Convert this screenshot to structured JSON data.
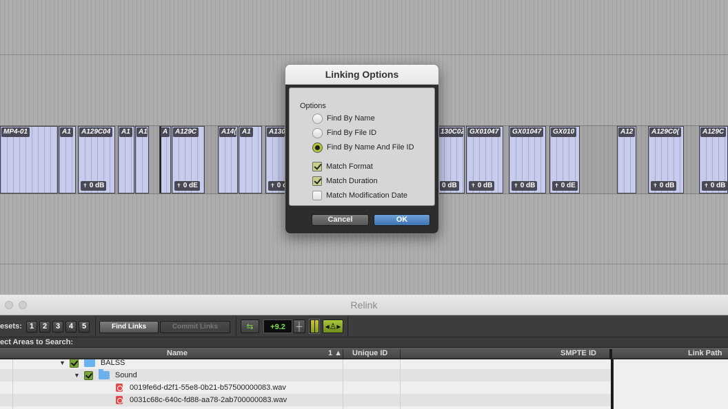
{
  "timeline": {
    "clips": [
      {
        "name": "MP4-01",
        "gain": ""
      },
      {
        "name": "A1",
        "gain": ""
      },
      {
        "name": "A129C04",
        "gain": "0 dB"
      },
      {
        "name": "A1",
        "gain": ""
      },
      {
        "name": "A1",
        "gain": ""
      },
      {
        "name": "A",
        "gain": ""
      },
      {
        "name": "A129C",
        "gain": "0 dE"
      },
      {
        "name": "A14(",
        "gain": ""
      },
      {
        "name": "A1",
        "gain": ""
      },
      {
        "name": "A130",
        "gain": "0 d"
      },
      {
        "name": "130C0Z",
        "gain": "0 dB"
      },
      {
        "name": "GX01047",
        "gain": "0 dB"
      },
      {
        "name": "GX01047",
        "gain": "0 dB"
      },
      {
        "name": "GX010",
        "gain": "0 dE"
      },
      {
        "name": "A12",
        "gain": ""
      },
      {
        "name": "A129C0(",
        "gain": "0 dB"
      },
      {
        "name": "A129C",
        "gain": "0 dB"
      }
    ]
  },
  "dialog": {
    "title": "Linking Options",
    "options_heading": "Options",
    "radios": [
      {
        "label": "Find By Name",
        "selected": false
      },
      {
        "label": "Find By File ID",
        "selected": false
      },
      {
        "label": "Find By Name And File ID",
        "selected": true
      }
    ],
    "checks": [
      {
        "label": "Match Format",
        "checked": true
      },
      {
        "label": "Match Duration",
        "checked": true
      },
      {
        "label": "Match Modification Date",
        "checked": false
      }
    ],
    "cancel_label": "Cancel",
    "ok_label": "OK"
  },
  "relink": {
    "title": "Relink",
    "presets_label": "esets:",
    "presets": [
      "1",
      "2",
      "3",
      "4",
      "5"
    ],
    "find_links_label": "Find Links",
    "commit_links_label": "Commit Links",
    "readout": "+9.2",
    "select_areas_label": "ect Areas to Search:",
    "columns": {
      "name": "Name",
      "sort": "1 ▲",
      "unique_id": "Unique ID",
      "smpte_id": "SMPTE ID",
      "link_path": "Link Path"
    },
    "tree": [
      {
        "label": "BALSS",
        "type": "folder"
      },
      {
        "label": "Sound",
        "type": "folder"
      },
      {
        "label": "0019fe6d-d2f1-55e8-0b21-b57500000083.wav",
        "type": "file"
      },
      {
        "label": "0031c68c-640c-fd88-aa78-2ab700000083.wav",
        "type": "file"
      }
    ]
  },
  "colors": {
    "accent_blue": "#4f80c0",
    "clip_fill": "#c8ccec",
    "readout_green": "#7fe04d"
  }
}
